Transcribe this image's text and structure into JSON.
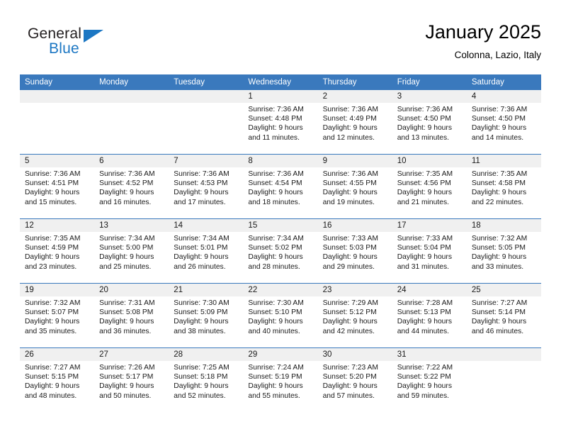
{
  "brand": {
    "word_one": "General",
    "word_two": "Blue",
    "triangle_color": "#1c77c3",
    "text_color": "#231f20"
  },
  "header": {
    "title": "January 2025",
    "location": "Colonna, Lazio, Italy"
  },
  "theme": {
    "header_bg": "#3a79bd",
    "header_text": "#ffffff",
    "date_band_bg": "#f0f0f0",
    "row_rule": "#3a79bd"
  },
  "weekday_headers": [
    "Sunday",
    "Monday",
    "Tuesday",
    "Wednesday",
    "Thursday",
    "Friday",
    "Saturday"
  ],
  "weeks": [
    [
      {
        "day": "",
        "sunrise": "",
        "sunset": "",
        "daylight": ""
      },
      {
        "day": "",
        "sunrise": "",
        "sunset": "",
        "daylight": ""
      },
      {
        "day": "",
        "sunrise": "",
        "sunset": "",
        "daylight": ""
      },
      {
        "day": "1",
        "sunrise": "Sunrise: 7:36 AM",
        "sunset": "Sunset: 4:48 PM",
        "daylight": "Daylight: 9 hours and 11 minutes."
      },
      {
        "day": "2",
        "sunrise": "Sunrise: 7:36 AM",
        "sunset": "Sunset: 4:49 PM",
        "daylight": "Daylight: 9 hours and 12 minutes."
      },
      {
        "day": "3",
        "sunrise": "Sunrise: 7:36 AM",
        "sunset": "Sunset: 4:50 PM",
        "daylight": "Daylight: 9 hours and 13 minutes."
      },
      {
        "day": "4",
        "sunrise": "Sunrise: 7:36 AM",
        "sunset": "Sunset: 4:50 PM",
        "daylight": "Daylight: 9 hours and 14 minutes."
      }
    ],
    [
      {
        "day": "5",
        "sunrise": "Sunrise: 7:36 AM",
        "sunset": "Sunset: 4:51 PM",
        "daylight": "Daylight: 9 hours and 15 minutes."
      },
      {
        "day": "6",
        "sunrise": "Sunrise: 7:36 AM",
        "sunset": "Sunset: 4:52 PM",
        "daylight": "Daylight: 9 hours and 16 minutes."
      },
      {
        "day": "7",
        "sunrise": "Sunrise: 7:36 AM",
        "sunset": "Sunset: 4:53 PM",
        "daylight": "Daylight: 9 hours and 17 minutes."
      },
      {
        "day": "8",
        "sunrise": "Sunrise: 7:36 AM",
        "sunset": "Sunset: 4:54 PM",
        "daylight": "Daylight: 9 hours and 18 minutes."
      },
      {
        "day": "9",
        "sunrise": "Sunrise: 7:36 AM",
        "sunset": "Sunset: 4:55 PM",
        "daylight": "Daylight: 9 hours and 19 minutes."
      },
      {
        "day": "10",
        "sunrise": "Sunrise: 7:35 AM",
        "sunset": "Sunset: 4:56 PM",
        "daylight": "Daylight: 9 hours and 21 minutes."
      },
      {
        "day": "11",
        "sunrise": "Sunrise: 7:35 AM",
        "sunset": "Sunset: 4:58 PM",
        "daylight": "Daylight: 9 hours and 22 minutes."
      }
    ],
    [
      {
        "day": "12",
        "sunrise": "Sunrise: 7:35 AM",
        "sunset": "Sunset: 4:59 PM",
        "daylight": "Daylight: 9 hours and 23 minutes."
      },
      {
        "day": "13",
        "sunrise": "Sunrise: 7:34 AM",
        "sunset": "Sunset: 5:00 PM",
        "daylight": "Daylight: 9 hours and 25 minutes."
      },
      {
        "day": "14",
        "sunrise": "Sunrise: 7:34 AM",
        "sunset": "Sunset: 5:01 PM",
        "daylight": "Daylight: 9 hours and 26 minutes."
      },
      {
        "day": "15",
        "sunrise": "Sunrise: 7:34 AM",
        "sunset": "Sunset: 5:02 PM",
        "daylight": "Daylight: 9 hours and 28 minutes."
      },
      {
        "day": "16",
        "sunrise": "Sunrise: 7:33 AM",
        "sunset": "Sunset: 5:03 PM",
        "daylight": "Daylight: 9 hours and 29 minutes."
      },
      {
        "day": "17",
        "sunrise": "Sunrise: 7:33 AM",
        "sunset": "Sunset: 5:04 PM",
        "daylight": "Daylight: 9 hours and 31 minutes."
      },
      {
        "day": "18",
        "sunrise": "Sunrise: 7:32 AM",
        "sunset": "Sunset: 5:05 PM",
        "daylight": "Daylight: 9 hours and 33 minutes."
      }
    ],
    [
      {
        "day": "19",
        "sunrise": "Sunrise: 7:32 AM",
        "sunset": "Sunset: 5:07 PM",
        "daylight": "Daylight: 9 hours and 35 minutes."
      },
      {
        "day": "20",
        "sunrise": "Sunrise: 7:31 AM",
        "sunset": "Sunset: 5:08 PM",
        "daylight": "Daylight: 9 hours and 36 minutes."
      },
      {
        "day": "21",
        "sunrise": "Sunrise: 7:30 AM",
        "sunset": "Sunset: 5:09 PM",
        "daylight": "Daylight: 9 hours and 38 minutes."
      },
      {
        "day": "22",
        "sunrise": "Sunrise: 7:30 AM",
        "sunset": "Sunset: 5:10 PM",
        "daylight": "Daylight: 9 hours and 40 minutes."
      },
      {
        "day": "23",
        "sunrise": "Sunrise: 7:29 AM",
        "sunset": "Sunset: 5:12 PM",
        "daylight": "Daylight: 9 hours and 42 minutes."
      },
      {
        "day": "24",
        "sunrise": "Sunrise: 7:28 AM",
        "sunset": "Sunset: 5:13 PM",
        "daylight": "Daylight: 9 hours and 44 minutes."
      },
      {
        "day": "25",
        "sunrise": "Sunrise: 7:27 AM",
        "sunset": "Sunset: 5:14 PM",
        "daylight": "Daylight: 9 hours and 46 minutes."
      }
    ],
    [
      {
        "day": "26",
        "sunrise": "Sunrise: 7:27 AM",
        "sunset": "Sunset: 5:15 PM",
        "daylight": "Daylight: 9 hours and 48 minutes."
      },
      {
        "day": "27",
        "sunrise": "Sunrise: 7:26 AM",
        "sunset": "Sunset: 5:17 PM",
        "daylight": "Daylight: 9 hours and 50 minutes."
      },
      {
        "day": "28",
        "sunrise": "Sunrise: 7:25 AM",
        "sunset": "Sunset: 5:18 PM",
        "daylight": "Daylight: 9 hours and 52 minutes."
      },
      {
        "day": "29",
        "sunrise": "Sunrise: 7:24 AM",
        "sunset": "Sunset: 5:19 PM",
        "daylight": "Daylight: 9 hours and 55 minutes."
      },
      {
        "day": "30",
        "sunrise": "Sunrise: 7:23 AM",
        "sunset": "Sunset: 5:20 PM",
        "daylight": "Daylight: 9 hours and 57 minutes."
      },
      {
        "day": "31",
        "sunrise": "Sunrise: 7:22 AM",
        "sunset": "Sunset: 5:22 PM",
        "daylight": "Daylight: 9 hours and 59 minutes."
      },
      {
        "day": "",
        "sunrise": "",
        "sunset": "",
        "daylight": ""
      }
    ]
  ]
}
